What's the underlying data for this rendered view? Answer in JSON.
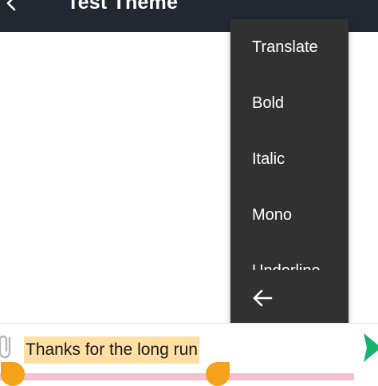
{
  "app_bar": {
    "title": "Test Theme"
  },
  "menu": {
    "items": [
      {
        "label": "Translate"
      },
      {
        "label": "Bold"
      },
      {
        "label": "Italic"
      },
      {
        "label": "Mono"
      },
      {
        "label": "Underline"
      }
    ]
  },
  "input": {
    "value": "Thanks for the long run"
  },
  "colors": {
    "app_bar": "#222831",
    "menu_bg": "#313131",
    "selection": "#ffdfa3",
    "handle": "#f6a31b",
    "send": "#16b36a"
  },
  "icons": {
    "back": "chevron-left-icon",
    "menu_back": "arrow-left-icon",
    "attach": "paperclip-icon",
    "send": "send-icon"
  }
}
